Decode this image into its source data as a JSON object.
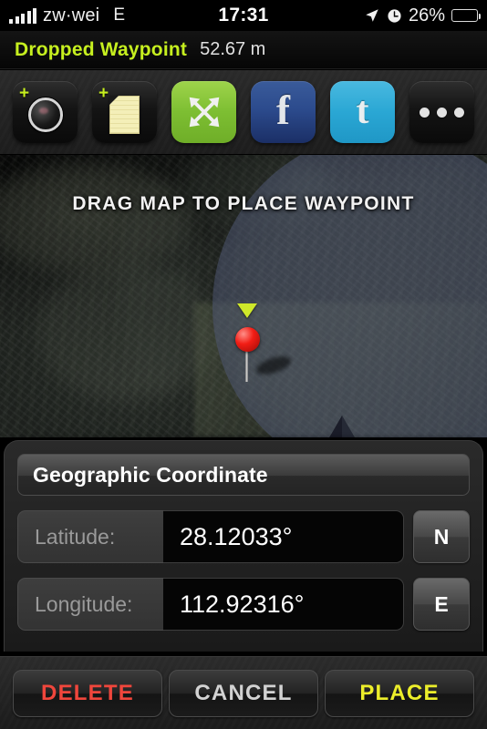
{
  "status_bar": {
    "signal_icon": "signal-bars-icon",
    "carrier": "zw·wei",
    "network_type": "E",
    "time": "17:31",
    "location_icon": "location-arrow-icon",
    "alarm_icon": "alarm-clock-icon",
    "battery_percent": "26%",
    "battery_level": 26,
    "battery_icon": "battery-icon"
  },
  "title_bar": {
    "waypoint_name": "Dropped Waypoint",
    "distance": "52.67 m",
    "accent_color": "#c6ef1f"
  },
  "toolbar": {
    "buttons": [
      {
        "name": "add-photo",
        "icon": "camera-icon",
        "badge": "+"
      },
      {
        "name": "add-note",
        "icon": "note-icon",
        "badge": "+"
      },
      {
        "name": "expand-map",
        "icon": "expand-arrows-icon",
        "color": "#7dbe32"
      },
      {
        "name": "share-facebook",
        "icon": "facebook-icon",
        "label": "f",
        "color": "#2c4b8d"
      },
      {
        "name": "share-twitter",
        "icon": "twitter-icon",
        "label": "t",
        "color": "#2aa7d4"
      },
      {
        "name": "more-options",
        "icon": "ellipsis-icon"
      }
    ]
  },
  "map": {
    "instruction": "DRAG MAP TO PLACE WAYPOINT",
    "pin_icon": "map-pin-icon",
    "pin_marker_color": "#f21d15",
    "waypoint_triangle_color": "#cfe82a",
    "accuracy_circle_color": "#6a7294",
    "heading_icon": "heading-arrow-icon"
  },
  "coordinate_panel": {
    "header": "Geographic Coordinate",
    "latitude": {
      "label": "Latitude:",
      "value": "28.12033°",
      "hemisphere": "N"
    },
    "longitude": {
      "label": "Longitude:",
      "value": "112.92316°",
      "hemisphere": "E"
    }
  },
  "bottom_bar": {
    "delete_label": "DELETE",
    "cancel_label": "CANCEL",
    "place_label": "PLACE",
    "delete_color": "#f0463c",
    "cancel_color": "#d2d2d2",
    "place_color": "#ecee2a"
  }
}
